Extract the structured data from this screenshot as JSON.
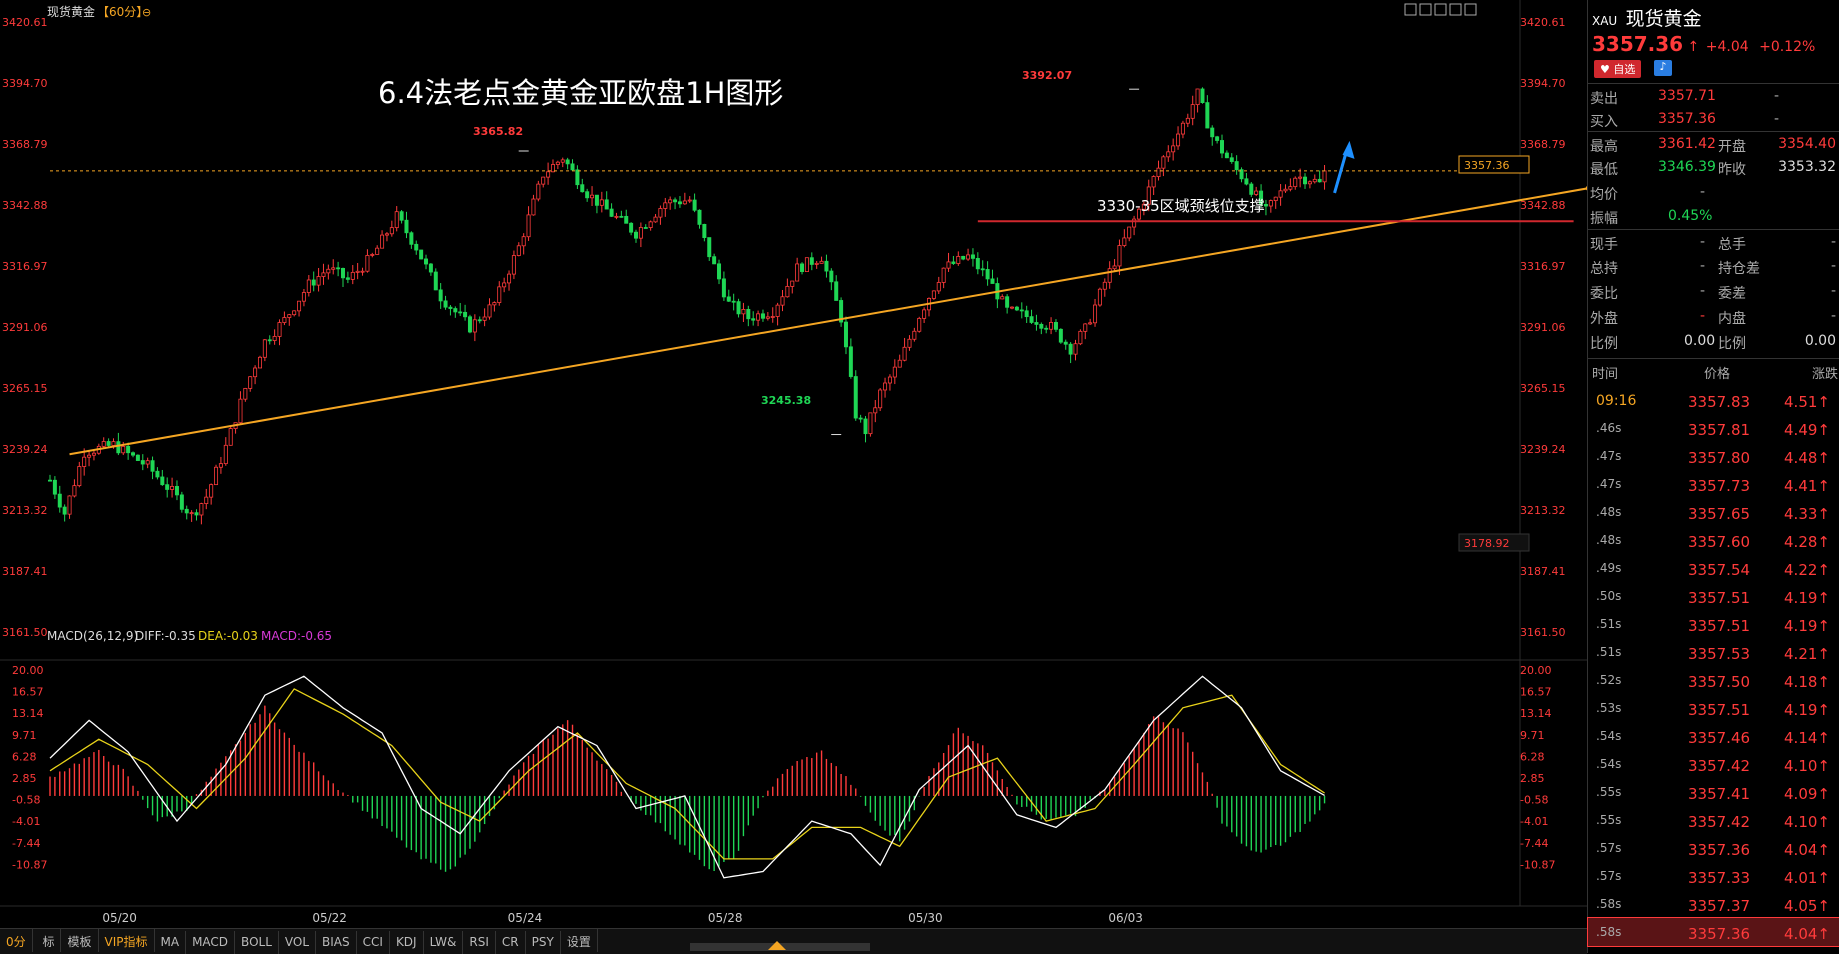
{
  "header": {
    "symbol_title": "现货黄金",
    "period_label": "【60分】"
  },
  "toolbar_icons": [
    "grid-icon",
    "layout-icon",
    "window-icon",
    "zoom-icon",
    "fullscreen-icon"
  ],
  "overlay": {
    "title": "6.4法老点金黄金亚欧盘1H图形",
    "support_label": "3330-35区域颈线位支撑",
    "high_label": "3392.07",
    "peak_label": "3365.82",
    "low_label": "3245.38",
    "current_price_tag": "3357.36",
    "low_tag": "3178.92"
  },
  "macd_legend": {
    "main": "MACD(26,12,9)",
    "diff": "DIFF:-0.35",
    "dea": "DEA:-0.03",
    "macd": "MACD:-0.65"
  },
  "tabbar": {
    "period": "0分",
    "tabs": [
      "标",
      "模板",
      "VIP指标",
      "MA",
      "MACD",
      "BOLL",
      "VOL",
      "BIAS",
      "CCI",
      "KDJ",
      "LW&",
      "RSI",
      "CR",
      "PSY",
      "设置"
    ]
  },
  "quote": {
    "code": "XAU",
    "name": "现货黄金",
    "price": "3357.36",
    "change": "+4.04",
    "change_pct": "+0.12%",
    "favorite_label": "自选",
    "sell_label": "卖出",
    "sell_price": "3357.71",
    "sell_vol": "-",
    "buy_label": "买入",
    "buy_price": "3357.36",
    "buy_vol": "-",
    "high_label": "最高",
    "high": "3361.42",
    "open_label": "开盘",
    "open": "3354.40",
    "low_label": "最低",
    "low": "3346.39",
    "prev_label": "昨收",
    "prev": "3353.32",
    "avg_label": "均价",
    "avg": "-",
    "amp_label": "振幅",
    "amp": "0.45%",
    "xianshou_label": "现手",
    "xianshou": "-",
    "zongshou_label": "总手",
    "zongshou": "-",
    "zongchi_label": "总持",
    "zongchi": "-",
    "chicang_label": "持仓差",
    "chicang": "-",
    "weibi_label": "委比",
    "weibi": "-",
    "weicha_label": "委差",
    "weicha": "-",
    "waipan_label": "外盘",
    "waipan": "-",
    "neipan_label": "内盘",
    "neipan": "-",
    "bili1_label": "比例",
    "bili1": "0.00",
    "bili2_label": "比例",
    "bili2": "0.00",
    "tick_headers": [
      "时间",
      "价格",
      "涨跌"
    ],
    "ticks": [
      {
        "time": "09:16",
        "price": "3357.83",
        "chg": "4.51"
      },
      {
        "time": ".46s",
        "price": "3357.81",
        "chg": "4.49"
      },
      {
        "time": ".47s",
        "price": "3357.80",
        "chg": "4.48"
      },
      {
        "time": ".47s",
        "price": "3357.73",
        "chg": "4.41"
      },
      {
        "time": ".48s",
        "price": "3357.65",
        "chg": "4.33"
      },
      {
        "time": ".48s",
        "price": "3357.60",
        "chg": "4.28"
      },
      {
        "time": ".49s",
        "price": "3357.54",
        "chg": "4.22"
      },
      {
        "time": ".50s",
        "price": "3357.51",
        "chg": "4.19"
      },
      {
        "time": ".51s",
        "price": "3357.51",
        "chg": "4.19"
      },
      {
        "time": ".51s",
        "price": "3357.53",
        "chg": "4.21"
      },
      {
        "time": ".52s",
        "price": "3357.50",
        "chg": "4.18"
      },
      {
        "time": ".53s",
        "price": "3357.51",
        "chg": "4.19"
      },
      {
        "time": ".54s",
        "price": "3357.46",
        "chg": "4.14"
      },
      {
        "time": ".54s",
        "price": "3357.42",
        "chg": "4.10"
      },
      {
        "time": ".55s",
        "price": "3357.41",
        "chg": "4.09"
      },
      {
        "time": ".55s",
        "price": "3357.42",
        "chg": "4.10"
      },
      {
        "time": ".57s",
        "price": "3357.36",
        "chg": "4.04"
      },
      {
        "time": ".57s",
        "price": "3357.33",
        "chg": "4.01"
      },
      {
        "time": ".58s",
        "price": "3357.37",
        "chg": "4.05"
      },
      {
        "time": ".58s",
        "price": "3357.36",
        "chg": "4.04"
      }
    ]
  },
  "colors": {
    "up": "#ff3b3b",
    "down": "#1fd655",
    "trend": "#f5a623",
    "support": "#d0282e",
    "arrow": "#1e90ff",
    "dea": "#e8d31a",
    "diff": "#ffffff"
  },
  "chart_data": {
    "type": "candlestick",
    "price_axis_ticks": [
      "3420.61",
      "3394.70",
      "3368.79",
      "3342.88",
      "3316.97",
      "3291.06",
      "3265.15",
      "3239.24",
      "3213.32",
      "3187.41",
      "3161.50"
    ],
    "price_ylim": [
      3161.5,
      3420.61
    ],
    "macd_axis_ticks": [
      "20.00",
      "16.57",
      "13.14",
      "9.71",
      "6.28",
      "2.85",
      "-0.58",
      "-4.01",
      "-7.44",
      "-10.87"
    ],
    "macd_ylim": [
      -14.3,
      20.0
    ],
    "x_labels": [
      "05/20",
      "05/22",
      "05/24",
      "05/28",
      "05/30",
      "06/03"
    ],
    "x_label_bar_index": [
      14,
      57,
      97,
      138,
      179,
      220
    ],
    "annotations": [
      {
        "label": "3392.07",
        "bar": 222,
        "price": 3392.07
      },
      {
        "label": "3365.82",
        "bar": 97,
        "price": 3365.82
      },
      {
        "label": "3245.38",
        "bar": 161,
        "price": 3245.38
      }
    ],
    "trendline": [
      {
        "bar": 4,
        "price": 3237.0
      },
      {
        "bar": 315,
        "price": 3350.0
      }
    ],
    "support_line": {
      "bar_start": 190,
      "bar_end": 312,
      "price": 3336.0
    },
    "current_price": 3357.36,
    "anchors": [
      [
        0,
        3226
      ],
      [
        3,
        3212
      ],
      [
        7,
        3238
      ],
      [
        13,
        3241
      ],
      [
        20,
        3232
      ],
      [
        25,
        3221
      ],
      [
        29,
        3211
      ],
      [
        32,
        3219
      ],
      [
        36,
        3240
      ],
      [
        40,
        3265
      ],
      [
        44,
        3285
      ],
      [
        48,
        3294
      ],
      [
        53,
        3309
      ],
      [
        57,
        3316
      ],
      [
        61,
        3311
      ],
      [
        66,
        3321
      ],
      [
        71,
        3338
      ],
      [
        75,
        3325
      ],
      [
        80,
        3304
      ],
      [
        86,
        3291
      ],
      [
        91,
        3301
      ],
      [
        96,
        3325
      ],
      [
        101,
        3356
      ],
      [
        105,
        3363
      ],
      [
        110,
        3348
      ],
      [
        115,
        3339
      ],
      [
        120,
        3331
      ],
      [
        126,
        3344
      ],
      [
        131,
        3345
      ],
      [
        135,
        3322
      ],
      [
        139,
        3301
      ],
      [
        143,
        3295
      ],
      [
        148,
        3298
      ],
      [
        153,
        3316
      ],
      [
        158,
        3321
      ],
      [
        162,
        3295
      ],
      [
        165,
        3254
      ],
      [
        167,
        3247
      ],
      [
        170,
        3263
      ],
      [
        174,
        3276
      ],
      [
        178,
        3296
      ],
      [
        183,
        3316
      ],
      [
        188,
        3321
      ],
      [
        192,
        3312
      ],
      [
        196,
        3298
      ],
      [
        201,
        3295
      ],
      [
        205,
        3291
      ],
      [
        209,
        3282
      ],
      [
        212,
        3290
      ],
      [
        216,
        3310
      ],
      [
        220,
        3328
      ],
      [
        224,
        3345
      ],
      [
        228,
        3363
      ],
      [
        232,
        3377
      ],
      [
        235,
        3390
      ],
      [
        238,
        3372
      ],
      [
        242,
        3360
      ],
      [
        245,
        3353
      ],
      [
        249,
        3340
      ],
      [
        252,
        3348
      ],
      [
        255,
        3355
      ],
      [
        258,
        3354
      ],
      [
        261,
        3351
      ]
    ],
    "macd_anchors": [
      [
        0,
        3
      ],
      [
        10,
        7
      ],
      [
        15,
        4
      ],
      [
        22,
        -4
      ],
      [
        28,
        -2
      ],
      [
        38,
        8
      ],
      [
        44,
        14
      ],
      [
        50,
        8
      ],
      [
        58,
        2
      ],
      [
        64,
        -2
      ],
      [
        70,
        -6
      ],
      [
        76,
        -10
      ],
      [
        82,
        -12
      ],
      [
        88,
        -6
      ],
      [
        94,
        2
      ],
      [
        100,
        8
      ],
      [
        106,
        12
      ],
      [
        112,
        6
      ],
      [
        118,
        0
      ],
      [
        124,
        -4
      ],
      [
        130,
        -8
      ],
      [
        135,
        -12
      ],
      [
        140,
        -10
      ],
      [
        146,
        0
      ],
      [
        152,
        5
      ],
      [
        158,
        7
      ],
      [
        164,
        2
      ],
      [
        170,
        -5
      ],
      [
        174,
        -7
      ],
      [
        180,
        3
      ],
      [
        186,
        11
      ],
      [
        192,
        7
      ],
      [
        198,
        -1
      ],
      [
        204,
        -4
      ],
      [
        210,
        -3
      ],
      [
        216,
        1
      ],
      [
        220,
        5
      ],
      [
        226,
        13
      ],
      [
        232,
        10
      ],
      [
        236,
        4
      ],
      [
        240,
        -4
      ],
      [
        246,
        -9
      ],
      [
        252,
        -8
      ],
      [
        258,
        -4
      ],
      [
        262,
        -0.65
      ]
    ],
    "diff_anchors": [
      [
        0,
        6
      ],
      [
        8,
        12
      ],
      [
        16,
        7
      ],
      [
        26,
        -4
      ],
      [
        36,
        5
      ],
      [
        44,
        16
      ],
      [
        52,
        19
      ],
      [
        60,
        14
      ],
      [
        68,
        10
      ],
      [
        76,
        -2
      ],
      [
        84,
        -6
      ],
      [
        94,
        4
      ],
      [
        104,
        11
      ],
      [
        112,
        8
      ],
      [
        120,
        -2
      ],
      [
        130,
        0
      ],
      [
        138,
        -13
      ],
      [
        146,
        -12
      ],
      [
        156,
        -4
      ],
      [
        164,
        -6
      ],
      [
        170,
        -11
      ],
      [
        178,
        1
      ],
      [
        188,
        8
      ],
      [
        198,
        -3
      ],
      [
        206,
        -5
      ],
      [
        216,
        1
      ],
      [
        226,
        12
      ],
      [
        236,
        19
      ],
      [
        244,
        14
      ],
      [
        252,
        4
      ],
      [
        262,
        -0.35
      ]
    ],
    "dea_anchors": [
      [
        0,
        4
      ],
      [
        10,
        9
      ],
      [
        20,
        5
      ],
      [
        30,
        -2
      ],
      [
        40,
        6
      ],
      [
        50,
        17
      ],
      [
        60,
        13
      ],
      [
        70,
        8
      ],
      [
        80,
        -1
      ],
      [
        88,
        -4
      ],
      [
        98,
        4
      ],
      [
        108,
        10
      ],
      [
        118,
        2
      ],
      [
        128,
        -2
      ],
      [
        138,
        -10
      ],
      [
        148,
        -10
      ],
      [
        156,
        -5
      ],
      [
        166,
        -5
      ],
      [
        174,
        -8
      ],
      [
        184,
        3
      ],
      [
        194,
        6
      ],
      [
        204,
        -4
      ],
      [
        214,
        -2
      ],
      [
        222,
        5
      ],
      [
        232,
        14
      ],
      [
        242,
        16
      ],
      [
        252,
        5
      ],
      [
        262,
        -0.03
      ]
    ]
  }
}
